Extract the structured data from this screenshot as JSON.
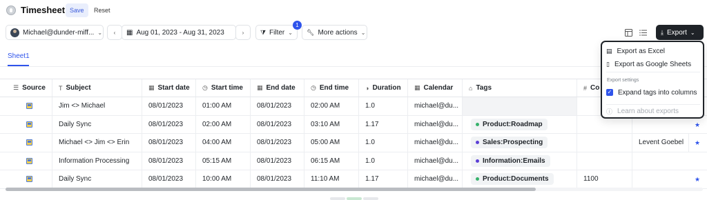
{
  "app": {
    "title": "Timesheet",
    "save_label": "Save",
    "reset_label": "Reset"
  },
  "toolbar": {
    "user": "Michael@dunder-miff...",
    "date_range": "Aug 01, 2023 - Aug 31, 2023",
    "filter_label": "Filter",
    "filter_count": "1",
    "more_actions_label": "More actions",
    "export_label": "Export"
  },
  "tabs": {
    "sheet": "Sheet1"
  },
  "table": {
    "headers": {
      "source": "Source",
      "subject": "Subject",
      "start_date": "Start date",
      "start_time": "Start time",
      "end_date": "End date",
      "end_time": "End time",
      "duration": "Duration",
      "calendar": "Calendar",
      "tags": "Tags",
      "count": "Co"
    },
    "rows": [
      {
        "subject": "Jim <> Michael",
        "start_date": "08/01/2023",
        "start_time": "01:00 AM",
        "end_date": "08/01/2023",
        "end_time": "02:00 AM",
        "duration": "1.0",
        "calendar": "michael@du...",
        "tag": "",
        "count": "",
        "extra": ""
      },
      {
        "subject": "Daily Sync",
        "start_date": "08/01/2023",
        "start_time": "02:00 AM",
        "end_date": "08/01/2023",
        "end_time": "03:10 AM",
        "duration": "1.17",
        "calendar": "michael@du...",
        "tag": "Product:Roadmap",
        "count": "",
        "extra": ""
      },
      {
        "subject": "Michael <> Jim <> Erin",
        "start_date": "08/01/2023",
        "start_time": "04:00 AM",
        "end_date": "08/01/2023",
        "end_time": "05:00 AM",
        "duration": "1.0",
        "calendar": "michael@du...",
        "tag": "Sales:Prospecting",
        "count": "",
        "extra": "Levent Goebel"
      },
      {
        "subject": "Information Processing",
        "start_date": "08/01/2023",
        "start_time": "05:15 AM",
        "end_date": "08/01/2023",
        "end_time": "06:15 AM",
        "duration": "1.0",
        "calendar": "michael@du...",
        "tag": "Information:Emails",
        "count": "",
        "extra": ""
      },
      {
        "subject": "Daily Sync",
        "start_date": "08/01/2023",
        "start_time": "10:00 AM",
        "end_date": "08/01/2023",
        "end_time": "11:10 AM",
        "duration": "1.17",
        "calendar": "michael@du...",
        "tag": "Product:Documents",
        "count": "1100",
        "extra": ""
      }
    ]
  },
  "export_menu": {
    "excel": "Export as Excel",
    "sheets": "Export as Google Sheets",
    "settings_heading": "Export settings",
    "expand_tags": "Expand tags into columns",
    "learn": "Learn about exports"
  },
  "colors": {
    "accent": "#2f54eb",
    "tag_green": "#37b26c",
    "tag_purple": "#5b3fd6",
    "dark": "#1f2328"
  }
}
